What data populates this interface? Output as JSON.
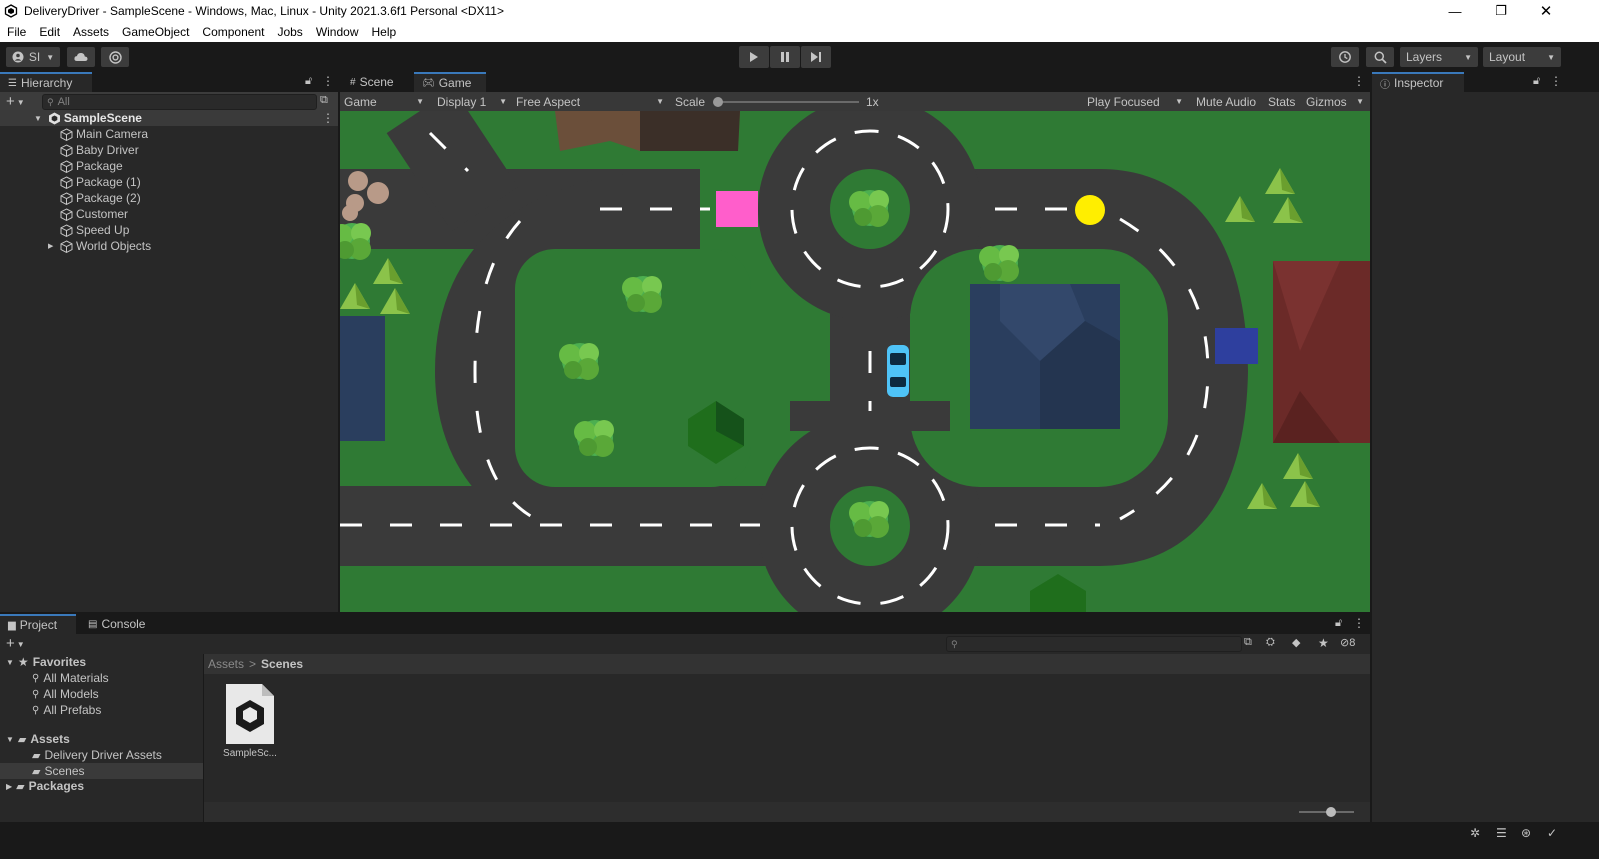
{
  "window": {
    "title": "DeliveryDriver - SampleScene - Windows, Mac, Linux - Unity 2021.3.6f1 Personal <DX11>"
  },
  "menu": [
    "File",
    "Edit",
    "Assets",
    "GameObject",
    "Component",
    "Jobs",
    "Window",
    "Help"
  ],
  "toolbar": {
    "account_label": "SI",
    "layers_label": "Layers",
    "layout_label": "Layout"
  },
  "hierarchy": {
    "tab_label": "Hierarchy",
    "search_placeholder": "All",
    "scene_name": "SampleScene",
    "items": [
      "Main Camera",
      "Baby Driver",
      "Package",
      "Package (1)",
      "Package (2)",
      "Customer",
      "Speed Up",
      "World Objects"
    ]
  },
  "game": {
    "tabs": [
      "Scene",
      "Game"
    ],
    "mode_label": "Game",
    "display_label": "Display 1",
    "aspect_label": "Free Aspect",
    "scale_label": "Scale",
    "scale_value": "1x",
    "play_focused": "Play Focused",
    "mute_audio": "Mute Audio",
    "stats": "Stats",
    "gizmos": "Gizmos"
  },
  "inspector": {
    "tab_label": "Inspector"
  },
  "project": {
    "tabs": [
      "Project",
      "Console"
    ],
    "favorites_label": "Favorites",
    "favorites": [
      "All Materials",
      "All Models",
      "All Prefabs"
    ],
    "assets_label": "Assets",
    "asset_folders": [
      "Delivery Driver Assets",
      "Scenes"
    ],
    "packages_label": "Packages",
    "breadcrumb": [
      "Assets",
      "Scenes"
    ],
    "file_label": "SampleSc...",
    "hidden_count": "8"
  },
  "colors": {
    "package": "#ff5ecb",
    "customer": "#2e3f9e",
    "speed_up": "#ffee00",
    "grass": "#2f7a34",
    "road": "#3a3a3a",
    "accent": "#3a79bb"
  }
}
